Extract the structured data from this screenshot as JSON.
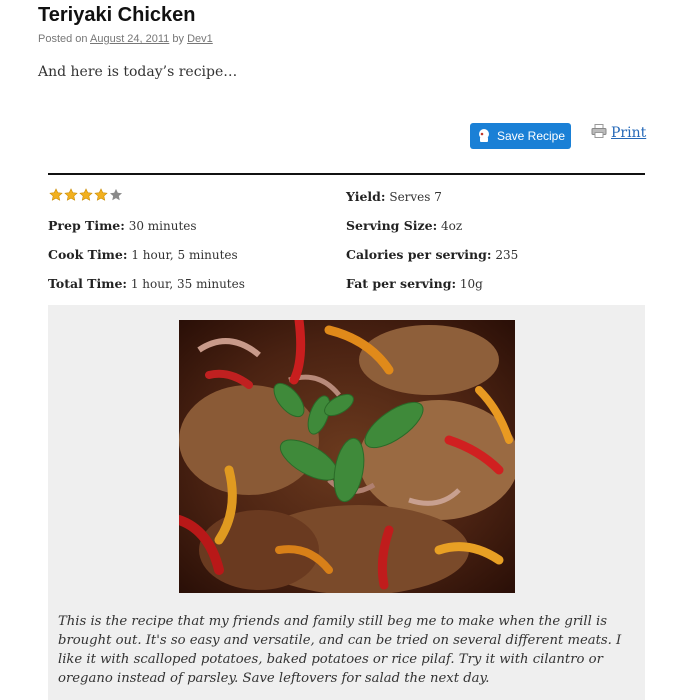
{
  "post": {
    "title": "Teriyaki Chicken",
    "posted_prefix": "Posted on",
    "date": "August 24, 2011",
    "by": "by",
    "author": "Dev1",
    "intro": "And here is today’s recipe…"
  },
  "actions": {
    "save_label": "Save Recipe",
    "print_label": "Print"
  },
  "recipe": {
    "rating": 4,
    "rating_max": 5,
    "prep_label": "Prep Time:",
    "prep_value": "30 minutes",
    "cook_label": "Cook Time:",
    "cook_value": "1 hour, 5 minutes",
    "total_label": "Total Time:",
    "total_value": "1 hour, 35 minutes",
    "yield_label": "Yield:",
    "yield_value": "Serves 7",
    "serving_label": "Serving Size:",
    "serving_value": "4oz",
    "calories_label": "Calories per serving:",
    "calories_value": "235",
    "fat_label": "Fat per serving:",
    "fat_value": "10g",
    "description": "This is the recipe that my friends and family still beg me to make when the grill is brought out. It's so easy and versatile, and can be tried on several different meats. I like it with scalloped potatoes, baked potatoes or rice pilaf. Try it with cilantro or oregano instead of parsley. Save leftovers for salad the next day."
  },
  "colors": {
    "save_button": "#1a80d6",
    "link": "#2468b8",
    "panel": "#efefef",
    "star_filled": "#f2b01e",
    "star_empty": "#8a8a8a"
  }
}
